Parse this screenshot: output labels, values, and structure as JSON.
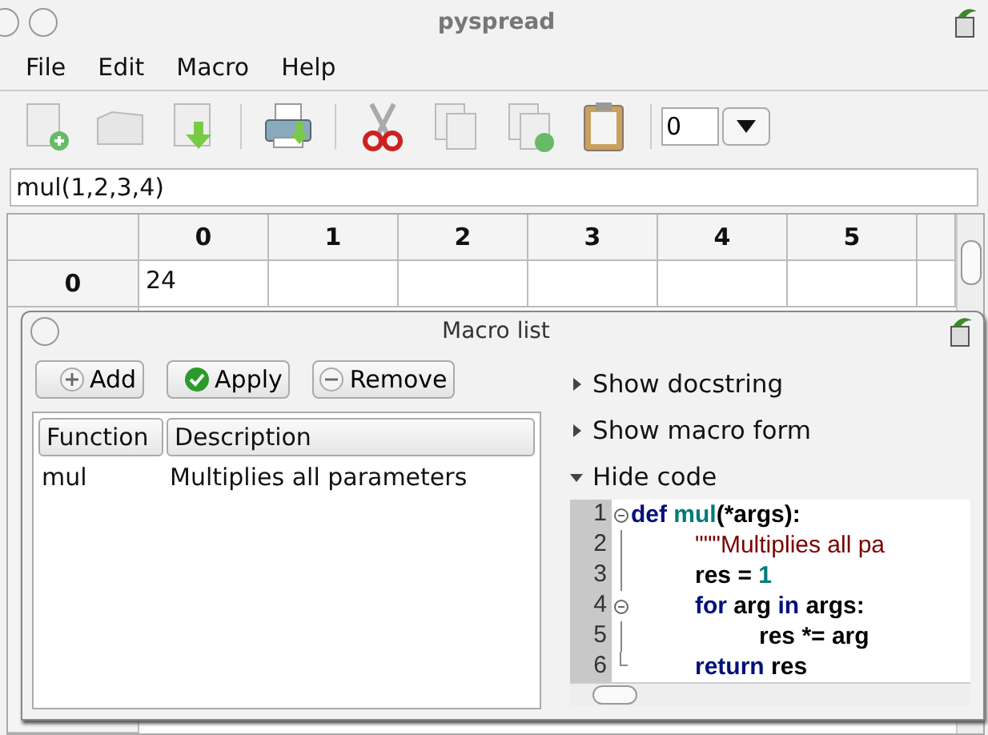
{
  "window": {
    "title": "pyspread"
  },
  "menu": [
    "File",
    "Edit",
    "Macro",
    "Help"
  ],
  "toolbar": [
    {
      "kind": "new"
    },
    {
      "kind": "open"
    },
    {
      "kind": "save"
    },
    {
      "kind": "sep"
    },
    {
      "kind": "print"
    },
    {
      "kind": "sep"
    },
    {
      "kind": "cut"
    },
    {
      "kind": "copy"
    },
    {
      "kind": "copyres"
    },
    {
      "kind": "paste"
    },
    {
      "kind": "sep"
    }
  ],
  "table_selector": {
    "value": "0"
  },
  "formula": {
    "value": "mul(1,2,3,4)"
  },
  "grid": {
    "columns": [
      "0",
      "1",
      "2",
      "3",
      "4",
      "5"
    ],
    "rows": [
      {
        "header": "0",
        "cells": [
          "24",
          "",
          "",
          "",
          "",
          ""
        ]
      }
    ]
  },
  "macro_dialog": {
    "title": "Macro list",
    "buttons": [
      {
        "kind": "add",
        "label": "Add"
      },
      {
        "kind": "apply",
        "label": "Apply"
      },
      {
        "kind": "remove",
        "label": "Remove"
      }
    ],
    "list": {
      "columns": [
        "Function",
        "Description"
      ],
      "rows": [
        {
          "function": "mul",
          "description": "Multiplies all parameters"
        }
      ]
    },
    "sections": [
      {
        "label": "Show docstring",
        "expanded": false
      },
      {
        "label": "Show macro form",
        "expanded": false
      },
      {
        "label": "Hide code",
        "expanded": true
      }
    ],
    "code": [
      {
        "number": "1",
        "kind": "fold-start",
        "tokens": [
          {
            "kind": "kw",
            "text": "def "
          },
          {
            "kind": "name",
            "text": "mul"
          },
          {
            "kind": "plain",
            "text": "(*args):"
          }
        ],
        "children": [
          {
            "number": "2",
            "kind": "fold-line",
            "tokens": [
              {
                "kind": "str",
                "text": "\"\"\"Multiplies all pa"
              }
            ]
          },
          {
            "number": "3",
            "kind": "fold-line",
            "tokens": [
              {
                "kind": "plain",
                "text": "res = "
              },
              {
                "kind": "num",
                "text": "1"
              }
            ]
          },
          {
            "number": "4",
            "kind": "fold-start",
            "tokens": [
              {
                "kind": "kw",
                "text": "for"
              },
              {
                "kind": "plain",
                "text": " arg "
              },
              {
                "kind": "kw",
                "text": "in"
              },
              {
                "kind": "plain",
                "text": " args:"
              }
            ],
            "children": [
              {
                "number": "5",
                "kind": "fold-line",
                "tokens": [
                  {
                    "kind": "plain",
                    "text": "res *= arg"
                  }
                ]
              }
            ]
          },
          {
            "number": "6",
            "kind": "fold-end",
            "tokens": [
              {
                "kind": "kw",
                "text": "return"
              },
              {
                "kind": "plain",
                "text": " res"
              }
            ]
          }
        ]
      }
    ]
  }
}
